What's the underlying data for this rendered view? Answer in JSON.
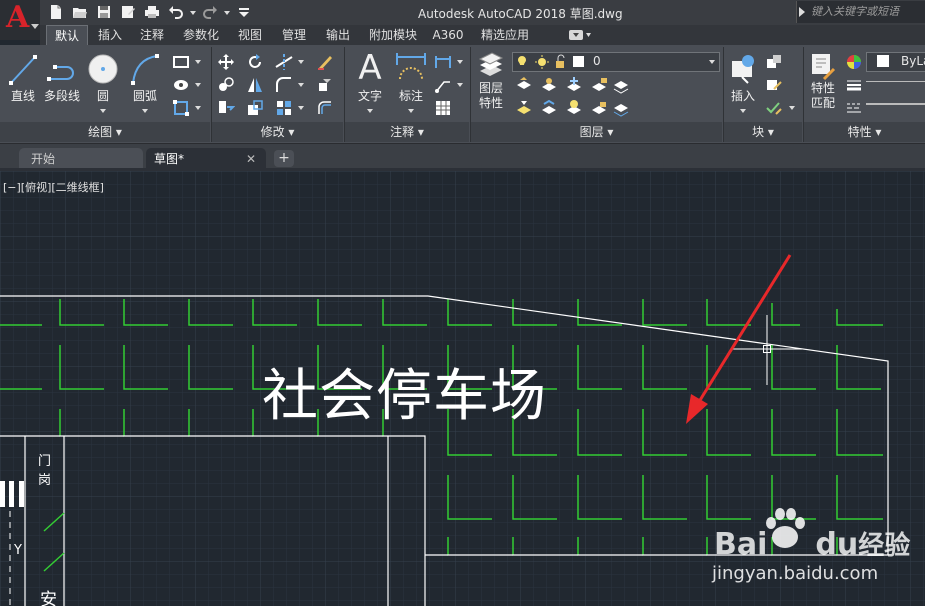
{
  "titlebar": {
    "window_title": "Autodesk AutoCAD 2018    草图.dwg",
    "search_placeholder": "键入关键字或短语"
  },
  "ribbon_tabs": [
    "默认",
    "插入",
    "注释",
    "参数化",
    "视图",
    "管理",
    "输出",
    "附加模块",
    "A360",
    "精选应用"
  ],
  "ribbon": {
    "draw": {
      "line": "直线",
      "polyline": "多段线",
      "circle": "圆",
      "arc": "圆弧",
      "footer": "绘图"
    },
    "modify": {
      "footer": "修改"
    },
    "annotation": {
      "text_label": "文字",
      "dim": "标注",
      "footer": "注释"
    },
    "layers": {
      "layer_props_1": "图层",
      "layer_props_2": "特性",
      "current_layer": "0",
      "footer": "图层"
    },
    "block": {
      "insert": "插入",
      "footer": "块"
    },
    "properties": {
      "match_1": "特性",
      "match_2": "匹配",
      "bylayer": "ByLa",
      "footer": "特性"
    }
  },
  "doc_tabs": [
    {
      "label": "开始"
    },
    {
      "label": "草图*"
    }
  ],
  "canvas": {
    "view_label": "[−][俯视][二维线框]",
    "lot_title": "社会停车场",
    "gate_label": "门岗",
    "an_label": "安",
    "y_label": "Y"
  },
  "watermark": {
    "logo_a": "Bai",
    "logo_b": "du",
    "logo_c": "经验",
    "url": "jingyan.baidu.com"
  },
  "colors": {
    "accent_red": "#d8232a",
    "canvas_bg": "#212830",
    "parking_green": "#33cc33",
    "arrow_red": "#e8282a"
  }
}
